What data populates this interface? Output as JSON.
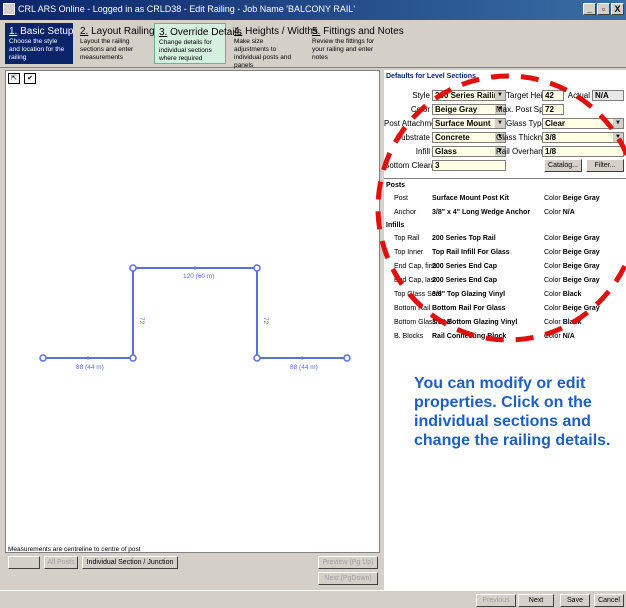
{
  "window": {
    "title": "CRL ARS Online - Logged in as CRLD38 - Edit Railing - Job Name 'BALCONY RAIL'",
    "btn_min": "_",
    "btn_max": "8",
    "btn_close": "X"
  },
  "steps": [
    {
      "num": "1.",
      "title": "Basic Setup",
      "desc": "Choose the style and location for the railing"
    },
    {
      "num": "2.",
      "title": "Layout Railing",
      "desc": "Layout the railing sections and enter measurements"
    },
    {
      "num": "3.",
      "title": "Override Details",
      "desc": "Change details for individual sections where required"
    },
    {
      "num": "4.",
      "title": "Heights / Widths",
      "desc": "Make size adjustments to individual posts and panels"
    },
    {
      "num": "5.",
      "title": "Fittings and Notes",
      "desc": "Review the fittings for your railing and enter notes"
    }
  ],
  "canvas": {
    "tool1": "⇱",
    "tool2": "✔",
    "labels": {
      "top": "120 (60 m)",
      "left_vert": "72",
      "right_vert": "72",
      "left_bottom": "88 (44 m)",
      "right_bottom": "88 (44 m)"
    },
    "measure_note": "Measurements are centreline to centre of post"
  },
  "defaults": {
    "section_title": "Defaults for Level Sections",
    "fields": {
      "style_label": "Style",
      "style_value": "200 Series Railing",
      "target_height_label": "Target Height",
      "target_height_value": "42",
      "actual_label": "Actual",
      "actual_value": "N/A",
      "color_label": "Color",
      "color_value": "Beige Gray",
      "max_post_spacing_label": "Max. Post Spacing",
      "max_post_spacing_value": "72",
      "post_attachment_label": "Post Attachment",
      "post_attachment_value": "Surface Mount",
      "glass_type_label": "Glass Type",
      "glass_type_value": "Clear",
      "substrate_label": "Substrate",
      "substrate_value": "Concrete",
      "glass_thickness_label": "Glass Thickness",
      "glass_thickness_value": "3/8",
      "infill_label": "Infill",
      "infill_value": "Glass",
      "rail_overhang_label": "Rail Overhang",
      "rail_overhang_value": "1/8",
      "bottom_clearance_label": "Bottom Clearance",
      "bottom_clearance_value": "3"
    },
    "catalog_button": "Catalog...",
    "filter_button": "Filter..."
  },
  "parts": {
    "posts_header": "Posts",
    "posts": [
      {
        "name": "Post",
        "item": "Surface Mount Post Kit",
        "color_label": "Color",
        "color": "Beige Gray"
      },
      {
        "name": "Anchor",
        "item": "3/8\" x 4\" Long Wedge Anchor",
        "color_label": "Color",
        "color": "N/A"
      }
    ],
    "infills_header": "Infills",
    "infills": [
      {
        "name": "Top Rail",
        "item": "200 Series Top Rail",
        "color_label": "Color",
        "color": "Beige Gray"
      },
      {
        "name": "Top Inner",
        "item": "Top Rail Infill For Glass",
        "color_label": "Color",
        "color": "Beige Gray"
      },
      {
        "name": "End Cap, first",
        "item": "200 Series End Cap",
        "color_label": "Color",
        "color": "Beige Gray"
      },
      {
        "name": "End Cap, last",
        "item": "200 Series End Cap",
        "color_label": "Color",
        "color": "Beige Gray"
      },
      {
        "name": "Top Glass Seal",
        "item": "3/8\" Top Glazing Vinyl",
        "color_label": "Color",
        "color": "Black"
      },
      {
        "name": "Bottom Rail",
        "item": "Bottom Rail For Glass",
        "color_label": "Color",
        "color": "Beige Gray"
      },
      {
        "name": "Bottom Glass Seal",
        "item": "3/8\" Bottom Glazing Vinyl",
        "color_label": "Color",
        "color": "Black"
      },
      {
        "name": "B. Blocks",
        "item": "Rail Connecting Block",
        "color_label": "Color",
        "color": "N/A"
      }
    ]
  },
  "callout": "You can modify or edit properties. Click on the individual sections and change the railing details.",
  "canvas_buttons": {
    "left_disabled": "",
    "all_posts": "All Posts",
    "individual": "Individual Section / Junction",
    "preview": "Preview (Pg Up)",
    "next_pg": "Next (PgDown)"
  },
  "footer": {
    "previous": "Previous",
    "next": "Next",
    "save": "Save",
    "cancel": "Cancel"
  },
  "colors": {
    "accent": "#0a246a",
    "annotation_red": "#e01010",
    "callout_blue": "#1f5fc2",
    "drawing_blue": "#5a6ee6"
  }
}
